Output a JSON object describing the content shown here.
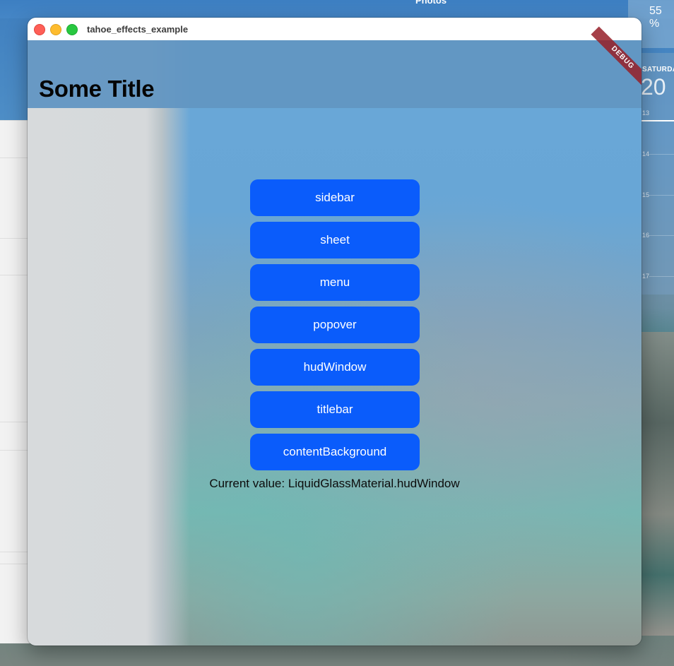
{
  "desktop": {
    "photos_label": "Photos",
    "battery_widget": {
      "text": "55 %"
    },
    "calendar_widget": {
      "day": "SATURDAY",
      "date": "20",
      "hours": [
        "13",
        "14",
        "15",
        "16",
        "17"
      ]
    }
  },
  "window": {
    "title": "tahoe_effects_example"
  },
  "appbar": {
    "title": "Some Title",
    "debug_banner": "DEBUG"
  },
  "buttons": [
    {
      "label": "sidebar"
    },
    {
      "label": "sheet"
    },
    {
      "label": "menu"
    },
    {
      "label": "popover"
    },
    {
      "label": "hudWindow"
    },
    {
      "label": "titlebar"
    },
    {
      "label": "contentBackground"
    }
  ],
  "status": {
    "current_value": "Current value: LiquidGlassMaterial.hudWindow"
  },
  "colors": {
    "button": "#0a5cfb",
    "appbar": "#6296c2",
    "debug_banner": "#961e28",
    "traffic_close": "#fe5f57",
    "traffic_minimize": "#febc2e",
    "traffic_zoom": "#28c840"
  }
}
